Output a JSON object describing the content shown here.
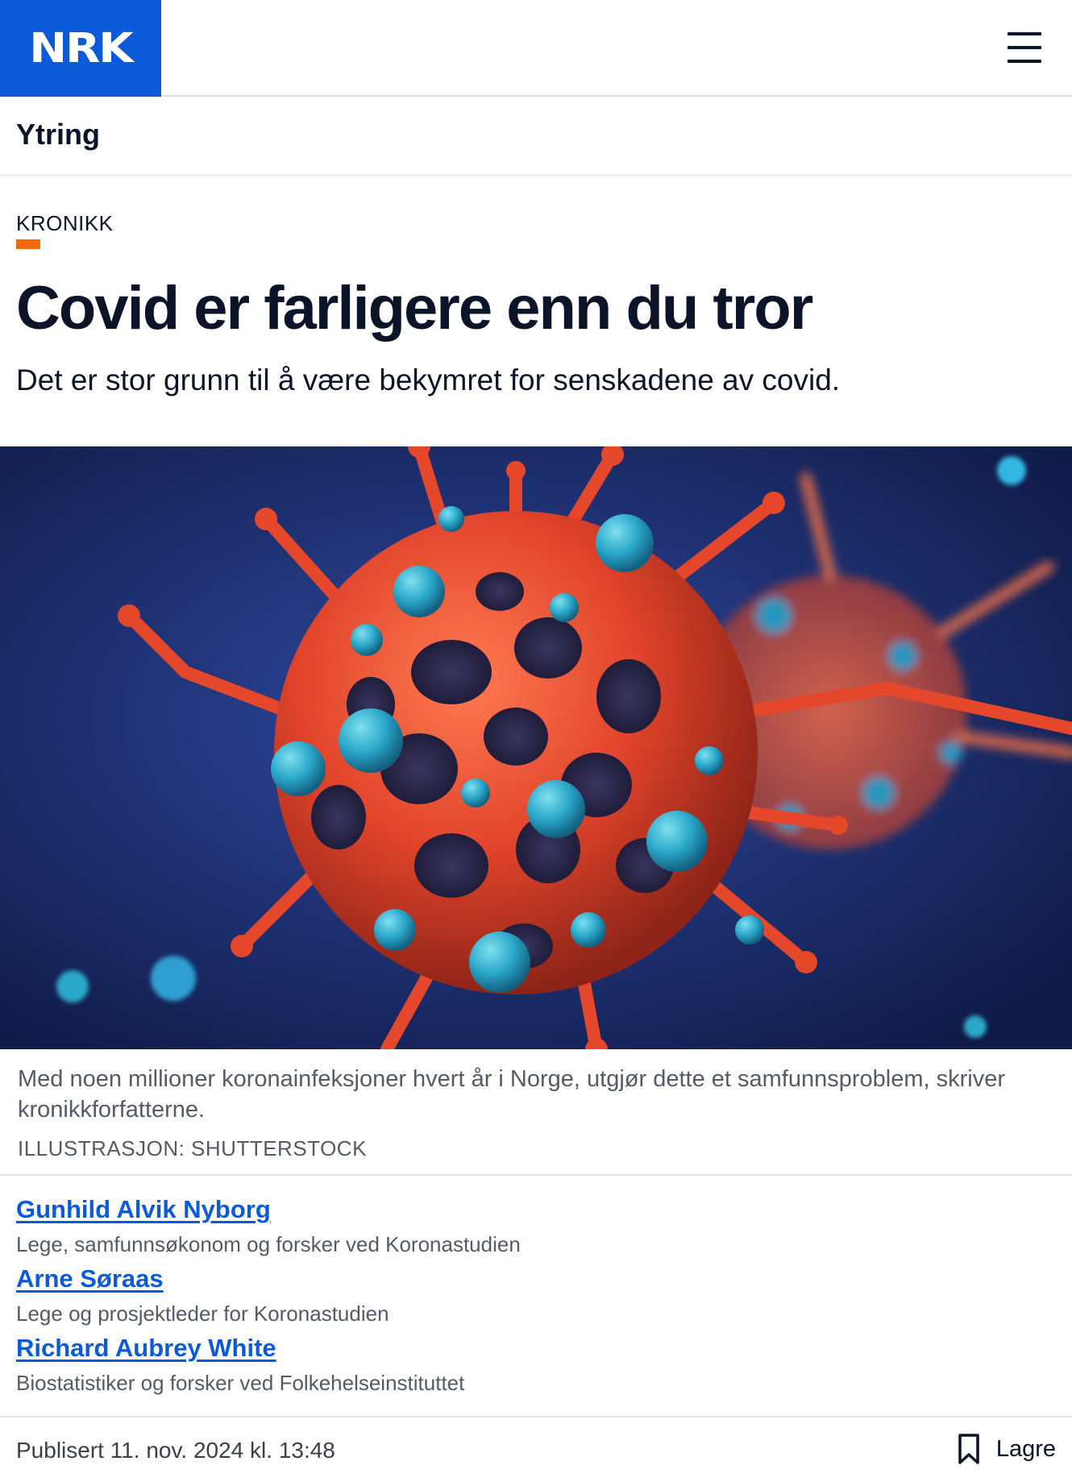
{
  "header": {
    "logo_text": "NRK",
    "menu_icon": "hamburger-menu-icon"
  },
  "section": {
    "title": "Ytring"
  },
  "article": {
    "kicker": "KRONIKK",
    "headline": "Covid er farligere enn du tror",
    "lede": "Det er stor grunn til å være bekymret for senskadene av covid.",
    "image_caption": "Med noen millioner koronainfeksjoner hvert år i Norge, utgjør dette et samfunnsproblem, skriver kronikkforfatterne.",
    "image_credit": "ILLUSTRASJON: SHUTTERSTOCK",
    "authors": [
      {
        "name": "Gunhild Alvik Nyborg",
        "role": "Lege, samfunnsøkonom og forsker ved Koronastudien"
      },
      {
        "name": "Arne Søraas",
        "role": "Lege og prosjektleder for Koronastudien"
      },
      {
        "name": "Richard Aubrey White",
        "role": "Biostatistiker og forsker ved Folkehelseinstituttet"
      }
    ],
    "published": "Publisert 11. nov. 2024 kl. 13:48",
    "save_label": "Lagre"
  },
  "colors": {
    "brand_blue": "#0c5ad8",
    "kicker_accent": "#f26a10",
    "virus_orange": "#e4472a",
    "virus_teal": "#2aa7c9"
  }
}
